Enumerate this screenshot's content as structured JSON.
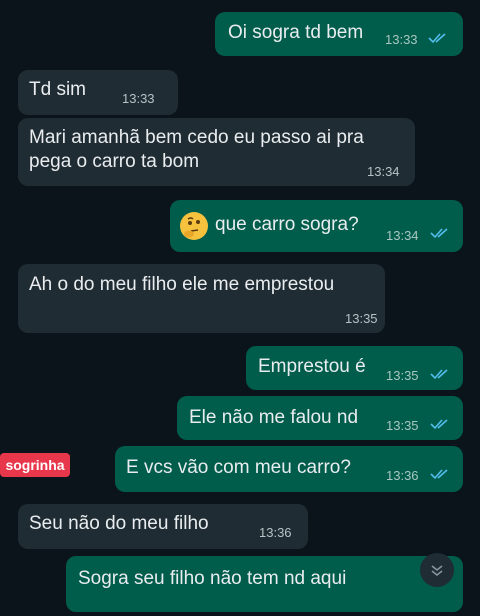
{
  "chat": {
    "messages": [
      {
        "dir": "out",
        "text": "Oi sogra td bem",
        "time": "13:33"
      },
      {
        "dir": "in",
        "text": "Td sim",
        "time": "13:33"
      },
      {
        "dir": "in",
        "text": "Mari amanhã bem cedo eu passo ai pra\npega o carro ta bom",
        "time": "13:34"
      },
      {
        "dir": "out",
        "text": "que carro sogra?",
        "time": "13:34",
        "emoji": "thinking-face"
      },
      {
        "dir": "in",
        "text": "Ah o do meu filho ele me emprestou",
        "time": "13:35"
      },
      {
        "dir": "out",
        "text": "Emprestou é",
        "time": "13:35"
      },
      {
        "dir": "out",
        "text": "Ele não me falou nd",
        "time": "13:35"
      },
      {
        "dir": "out",
        "text": "E vcs vão com meu carro?",
        "time": "13:36"
      },
      {
        "dir": "in",
        "text": "Seu não do meu filho",
        "time": "13:36"
      },
      {
        "dir": "out",
        "text": "Sogra seu filho não tem nd aqui",
        "time": ""
      }
    ]
  },
  "overlay": {
    "tag_label": "sogrinha"
  },
  "colors": {
    "background": "#0b141a",
    "incoming": "#202c33",
    "outgoing": "#005c4b",
    "tag": "#e8364b",
    "read_ticks": "#53bdeb"
  },
  "icons": [
    "double-check-icon",
    "thinking-face-emoji",
    "chevron-down-icon"
  ]
}
